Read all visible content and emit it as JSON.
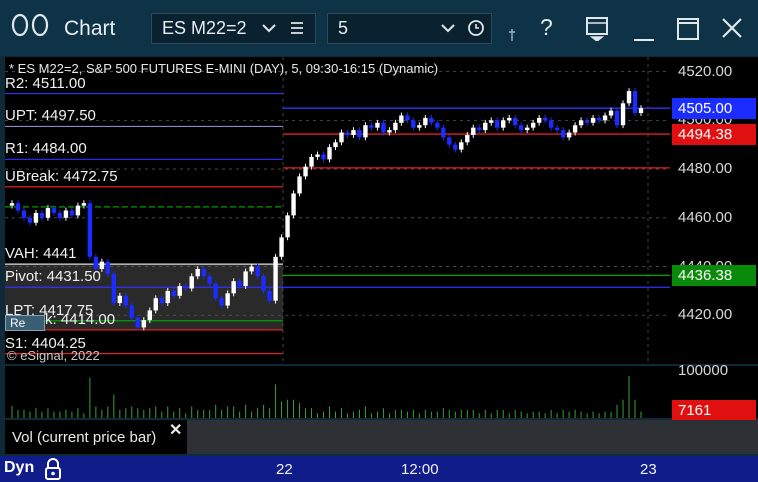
{
  "window": {
    "title": "Chart",
    "symbol": "ES M22=2",
    "interval": "5",
    "icons": [
      "app-logo-icon",
      "chevron-down-icon",
      "list-icon",
      "chevron-down-icon",
      "clock-icon",
      "pin-icon",
      "help-icon",
      "print-icon",
      "minimize-icon",
      "maximize-icon",
      "close-icon"
    ]
  },
  "chart": {
    "header": "* ES M22=2, S&P 500 FUTURES E-MINI (DAY), 5, 09:30-16:15 (Dynamic)",
    "copyright": "© eSignal, 2022",
    "re_button": "Re",
    "colors": {
      "up": "#ffffff",
      "down": "#1a2cff",
      "resistance": "#e02020",
      "support": "#00a000",
      "accent": "#1e6aff"
    },
    "levels": [
      {
        "label": "R2: 4511.00",
        "price": 4511.0
      },
      {
        "label": "UPT: 4497.50",
        "price": 4497.5
      },
      {
        "label": "R1: 4484.00",
        "price": 4484.0
      },
      {
        "label": "UBreak: 4472.75",
        "price": 4472.75
      },
      {
        "label": "VAH: 4441",
        "price": 4441.0
      },
      {
        "label": "Pivot: 4431.50",
        "price": 4431.5
      },
      {
        "label": "LPT: 4417.75",
        "price": 4417.75
      },
      {
        "label": "LBreak: 4414.00",
        "price": 4414.0
      },
      {
        "label": "S1: 4404.25",
        "price": 4404.25
      }
    ]
  },
  "price_axis": {
    "ticks": [
      "4520.00",
      "4500.00",
      "4480.00",
      "4460.00",
      "4440.00",
      "4420.00"
    ],
    "badges": [
      {
        "text": "4505.00",
        "color": "#1a2cff"
      },
      {
        "text": "4494.38",
        "color": "#e01010"
      },
      {
        "text": "4436.38",
        "color": "#0a8a0a"
      }
    ]
  },
  "volume": {
    "study_label": "Vol (current price bar)",
    "close_icon": "close-icon",
    "axis_tick": "100000",
    "current": "7161",
    "current_color": "#e01010"
  },
  "bottom_bar": {
    "mode": "Dyn",
    "lock_icon": "lock-icon",
    "time_labels": [
      "22",
      "12:00",
      "23"
    ]
  },
  "chart_data": {
    "type": "candlestick",
    "title": "* ES M22=2, S&P 500 FUTURES E-MINI (DAY), 5, 09:30-16:15 (Dynamic)",
    "x_labels": [
      "22",
      "12:00",
      "23"
    ],
    "ylim": [
      4400,
      4526
    ],
    "y_ticks": [
      4420,
      4440,
      4460,
      4480,
      4500,
      4520
    ],
    "last_price": 4505.0,
    "closes": [
      4466,
      4463,
      4460,
      4458,
      4462,
      4460,
      4464,
      4462,
      4460,
      4463,
      4461,
      4465,
      4466,
      4444,
      4439,
      4442,
      4437,
      4425,
      4428,
      4424,
      4419,
      4415,
      4418,
      4422,
      4427,
      4425,
      4430,
      4428,
      4432,
      4431,
      4436,
      4439,
      4436,
      4433,
      4427,
      4424,
      4429,
      4434,
      4432,
      4438,
      4440,
      4436,
      4430,
      4426,
      4444,
      4452,
      4461,
      4470,
      4477,
      4481,
      4485,
      4486,
      4484,
      4489,
      4491,
      4495,
      4494,
      4496,
      4493,
      4498,
      4497,
      4499,
      4495,
      4496,
      4499,
      4502,
      4500,
      4497,
      4498,
      4501,
      4499,
      4497,
      4493,
      4490,
      4488,
      4491,
      4494,
      4497,
      4496,
      4499,
      4500,
      4497,
      4500,
      4501,
      4498,
      4496,
      4497,
      4499,
      4501,
      4500,
      4497,
      4496,
      4493,
      4495,
      4498,
      4500,
      4499,
      4501,
      4500,
      4502,
      4504,
      4498,
      4507,
      4512,
      4503,
      4505
    ],
    "volume_note": "volume bars per candle; axis tick 100000, current 7161"
  }
}
